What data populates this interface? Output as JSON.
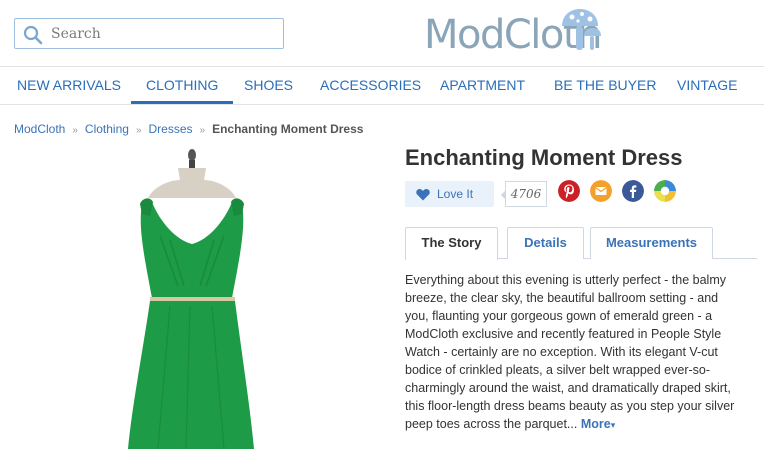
{
  "search": {
    "placeholder": "Search"
  },
  "logo": {
    "text": "ModCloth"
  },
  "nav": {
    "items": [
      {
        "label": "NEW ARRIVALS"
      },
      {
        "label": "CLOTHING"
      },
      {
        "label": "SHOES"
      },
      {
        "label": "ACCESSORIES"
      },
      {
        "label": "APARTMENT"
      },
      {
        "label": "BE THE BUYER"
      },
      {
        "label": "VINTAGE"
      }
    ],
    "active": "CLOTHING"
  },
  "breadcrumb": {
    "items": [
      "ModCloth",
      "Clothing",
      "Dresses"
    ],
    "separator": "»",
    "current": "Enchanting Moment Dress"
  },
  "product": {
    "title": "Enchanting Moment Dress",
    "love_label": "Love It",
    "love_count": "4706",
    "dress_color": "#1e9b46"
  },
  "share": [
    {
      "icon": "pinterest-icon",
      "color": "#cb2027"
    },
    {
      "icon": "email-icon",
      "color": "#f4a12b"
    },
    {
      "icon": "facebook-icon",
      "color": "#3b5998"
    },
    {
      "icon": "google-icon",
      "color": "#f2c12e"
    }
  ],
  "tabs": [
    {
      "label": "The Story"
    },
    {
      "label": "Details"
    },
    {
      "label": "Measurements"
    }
  ],
  "description": {
    "text": "Everything about this evening is utterly perfect - the balmy breeze, the clear sky, the beautiful ballroom setting - and you, flaunting your gorgeous gown of emerald green - a ModCloth exclusive and recently featured in People Style Watch - certainly are no exception. With its elegant V-cut bodice of crinkled pleats, a silver belt wrapped ever-so-charmingly around the waist, and dramatically draped skirt, this floor-length dress beams beauty as you step your silver peep toes across the parquet...",
    "more_label": "More",
    "more_caret": "▾"
  },
  "colors": {
    "accent": "#2a6ebb",
    "link": "#3a73b8"
  }
}
